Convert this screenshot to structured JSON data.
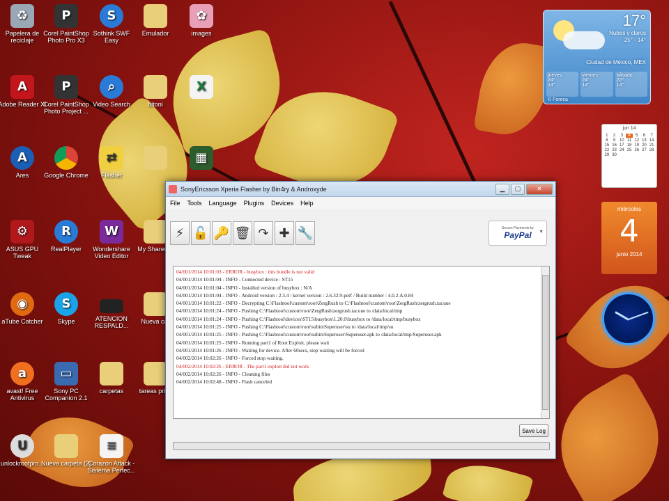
{
  "desktop": {
    "icons": [
      {
        "label": "Papelera de reciclaje",
        "icon": "recycle-bin-icon"
      },
      {
        "label": "Corel PaintShop Photo Pro X3",
        "icon": "paintshop-icon"
      },
      {
        "label": "Sothink SWF Easy",
        "icon": "swf-icon"
      },
      {
        "label": "Emulador",
        "icon": "folder-icon"
      },
      {
        "label": "images",
        "icon": "image-icon"
      },
      {
        "label": "Adobe Reader XI",
        "icon": "acrobat-icon"
      },
      {
        "label": "Corel PaintShop Photo Project ...",
        "icon": "paintshop-project-icon"
      },
      {
        "label": "Video Search",
        "icon": "video-search-icon"
      },
      {
        "label": "bitoni",
        "icon": "folder-icon"
      },
      {
        "label": "",
        "icon": "excel-file-icon"
      },
      {
        "label": "Ares",
        "icon": "ares-icon"
      },
      {
        "label": "Google Chrome",
        "icon": "chrome-icon"
      },
      {
        "label": "Flasher",
        "icon": "flasher-icon"
      },
      {
        "label": "",
        "icon": "folder-icon"
      },
      {
        "label": "",
        "icon": "app-icon"
      },
      {
        "label": "ASUS GPU Tweak",
        "icon": "asus-icon"
      },
      {
        "label": "RealPlayer",
        "icon": "realplayer-icon"
      },
      {
        "label": "Wondershare Video Editor",
        "icon": "wondershare-icon"
      },
      {
        "label": "My Shared F",
        "icon": "folder-icon"
      },
      {
        "label": "aTube Catcher",
        "icon": "atube-icon"
      },
      {
        "label": "Skype",
        "icon": "skype-icon"
      },
      {
        "label": "ATENCION RESPALD...",
        "icon": "drive-icon"
      },
      {
        "label": "Nueva car",
        "icon": "folder-icon"
      },
      {
        "label": "avast! Free Antivirus",
        "icon": "avast-icon"
      },
      {
        "label": "Sony PC Companion 2.1",
        "icon": "sony-icon"
      },
      {
        "label": "carpetas",
        "icon": "folder-icon"
      },
      {
        "label": "tareas pricc",
        "icon": "folder-icon"
      },
      {
        "label": "unlockrootpro...",
        "icon": "unlockroot-icon"
      },
      {
        "label": "Nueva carpeta (2)",
        "icon": "folder-icon"
      },
      {
        "label": "Corazon Attack - Sistema Perfec...",
        "icon": "document-icon"
      }
    ]
  },
  "weather": {
    "temp": "17°",
    "condition": "Nubes y claros",
    "range": "25° - 14°",
    "city": "Ciudad de México, MEX",
    "days": [
      {
        "name": "jueves",
        "hi": "24°",
        "lo": "14°"
      },
      {
        "name": "viernes",
        "hi": "24°",
        "lo": "14°"
      },
      {
        "name": "sábado",
        "hi": "22°",
        "lo": "14°"
      }
    ],
    "source": "© Foreca"
  },
  "calendar": {
    "month": "jun 14",
    "weekday": "miércoles",
    "day": "4",
    "month_year": "junio 2014",
    "days": [
      "1",
      "2",
      "3",
      "4",
      "5",
      "6",
      "7",
      "8",
      "9",
      "10",
      "11",
      "12",
      "13",
      "14",
      "15",
      "16",
      "17",
      "18",
      "19",
      "20",
      "21",
      "22",
      "23",
      "24",
      "25",
      "26",
      "27",
      "28",
      "29",
      "30"
    ]
  },
  "window": {
    "title": "SonyEricsson Xperia Flasher by Bin4ry & Androxyde",
    "menu": [
      "File",
      "Tools",
      "Language",
      "Plugins",
      "Devices",
      "Help"
    ],
    "toolbar": [
      {
        "icon": "flash-icon",
        "glyph": "⚡"
      },
      {
        "icon": "unlock-icon",
        "glyph": "🔓"
      },
      {
        "icon": "key-icon",
        "glyph": "🔑"
      },
      {
        "icon": "trash-icon",
        "glyph": "🗑"
      },
      {
        "icon": "redo-arrow-icon",
        "glyph": "↷"
      },
      {
        "icon": "plus-icon",
        "glyph": "✚"
      },
      {
        "icon": "wrench-icon",
        "glyph": "🔧"
      }
    ],
    "donate": {
      "caption": "Secure Payments by",
      "brand": "PayPal"
    },
    "log": [
      {
        "text": "04/001/2014 10:01:03 - ERROR - busybox : this bundle is not valid",
        "error": true
      },
      {
        "text": "04/001/2014 10:01:04 - INFO - Connected device : ST15",
        "error": false
      },
      {
        "text": "04/001/2014 10:01:04 - INFO - Installed version of busybox : N/A",
        "error": false
      },
      {
        "text": "04/001/2014 10:01:04 - INFO - Android version : 2.3.4 / kernel version : 2.6.32.9-perf / Build number : 4.0.2.A.0.84",
        "error": false
      },
      {
        "text": "04/001/2014 10:01:22 - INFO - Decrypting C:\\Flashtool\\custom\\root\\ZergRush to C:\\Flashtool\\custom\\root\\ZergRush\\zergrush.tar.uue",
        "error": false
      },
      {
        "text": "04/001/2014 10:01:24 - INFO - Pushing C:\\Flashtool\\custom\\root\\ZergRush\\zergrush.tar.uue to /data/local/tmp",
        "error": false
      },
      {
        "text": "04/001/2014 10:01:24 - INFO - Pushing C:\\Flashtool\\devices\\ST15\\busybox\\1.20.0\\busybox to /data/local/tmp/busybox",
        "error": false
      },
      {
        "text": "04/001/2014 10:01:25 - INFO - Pushing C:\\Flashtool\\custom\\root\\subin\\Superuser\\su to /data/local/tmp/su",
        "error": false
      },
      {
        "text": "04/001/2014 10:01:25 - INFO - Pushing C:\\Flashtool\\custom\\root\\subin\\Superuser\\Superuser.apk to /data/local/tmp/Superuser.apk",
        "error": false
      },
      {
        "text": "04/001/2014 10:01:25 - INFO - Running part1 of Root Exploit, please wait",
        "error": false
      },
      {
        "text": "04/001/2014 10:01:26 - INFO - Waiting for device. After 60secs, stop waiting will be forced",
        "error": false
      },
      {
        "text": "04/002/2014 10:02:26 - INFO - Forced stop waiting.",
        "error": false
      },
      {
        "text": "04/002/2014 10:02:26 - ERROR - The part1 exploit did not work",
        "error": true
      },
      {
        "text": "04/002/2014 10:02:26 - INFO - Cleaning files",
        "error": false
      },
      {
        "text": "04/002/2014 10:02:48 - INFO - Flash canceled",
        "error": false
      }
    ],
    "save_log": "Save Log",
    "progress": 0
  },
  "colors": {
    "error": "#d02020",
    "calendar_accent": "#e86a1c"
  }
}
